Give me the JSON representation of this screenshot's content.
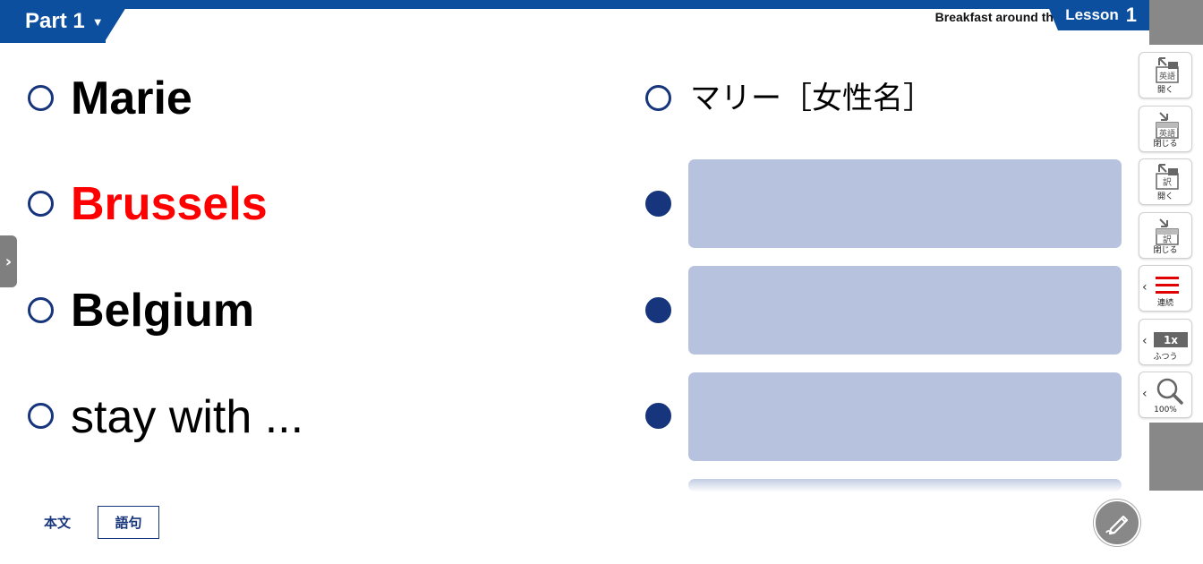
{
  "header": {
    "part_label": "Part 1",
    "lesson_title": "Breakfast around the World",
    "lesson_label": "Lesson",
    "lesson_number": "1"
  },
  "words": [
    {
      "text": "Marie",
      "style": "bold",
      "color": "#000000",
      "meaning": "マリー［女性名］",
      "meaning_shown": true
    },
    {
      "text": "Brussels",
      "style": "bold",
      "color": "#ff0000",
      "meaning": "",
      "meaning_shown": false
    },
    {
      "text": "Belgium",
      "style": "bold",
      "color": "#000000",
      "meaning": "",
      "meaning_shown": false
    },
    {
      "text": "stay with ...",
      "style": "normal",
      "color": "#000000",
      "meaning": "",
      "meaning_shown": false
    }
  ],
  "toolbar": [
    {
      "icon": "english-open-icon",
      "label": "開く",
      "glyph": "英語"
    },
    {
      "icon": "english-close-icon",
      "label": "閉じる",
      "glyph": "英語"
    },
    {
      "icon": "translation-open-icon",
      "label": "開く",
      "glyph": "訳"
    },
    {
      "icon": "translation-close-icon",
      "label": "閉じる",
      "glyph": "訳"
    },
    {
      "icon": "continuous-icon",
      "label": "連続"
    },
    {
      "icon": "speed-icon",
      "label": "ふつう",
      "glyph": "1x"
    },
    {
      "icon": "zoom-icon",
      "label": "100%"
    }
  ],
  "bottom_tabs": {
    "honbun": "本文",
    "goku": "語句"
  },
  "colors": {
    "brand_blue": "#0c4f9e",
    "circle_navy": "#17357c",
    "mask_blue": "#b7c3de",
    "highlight_red": "#ff0000",
    "panel_gray": "#888888"
  }
}
